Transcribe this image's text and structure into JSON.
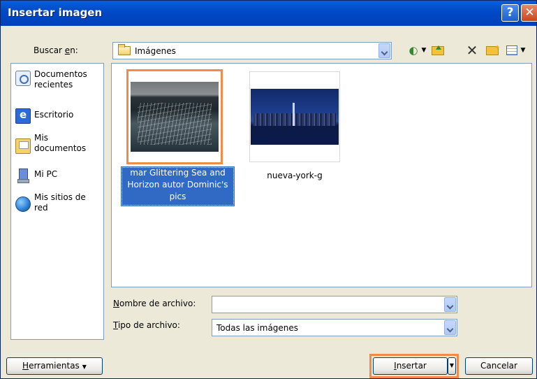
{
  "window": {
    "title": "Insertar imagen",
    "help_label": "?",
    "close_label": "✕"
  },
  "lookin": {
    "label": "Buscar en:",
    "value": "Imágenes"
  },
  "toolbar": {
    "back_icon": "back-arrow-icon",
    "up_icon": "up-folder-icon",
    "delete_icon": "delete-icon",
    "new_folder_icon": "new-folder-icon",
    "views_icon": "views-icon"
  },
  "places": [
    {
      "label": "Documentos recientes",
      "icon": "recent-documents-icon"
    },
    {
      "label": "Escritorio",
      "icon": "desktop-icon"
    },
    {
      "label": "Mis documentos",
      "icon": "my-documents-icon"
    },
    {
      "label": "Mi PC",
      "icon": "my-computer-icon"
    },
    {
      "label": "Mis sitios de red",
      "icon": "network-places-icon"
    }
  ],
  "files": [
    {
      "name": "mar Glittering Sea and Horizon autor Dominic's pics",
      "selected": true
    },
    {
      "name": "nueva-york-g",
      "selected": false
    }
  ],
  "fields": {
    "filename_label": "Nombre de archivo:",
    "filename_value": "",
    "filetype_label": "Tipo de archivo:",
    "filetype_value": "Todas las imágenes"
  },
  "buttons": {
    "tools": "Herramientas",
    "insert": "Insertar",
    "cancel": "Cancelar"
  },
  "colors": {
    "titlebar": "#0049c6",
    "selection": "#316ac5",
    "highlight": "#f28a4a",
    "dialog_bg": "#ece9d8"
  }
}
